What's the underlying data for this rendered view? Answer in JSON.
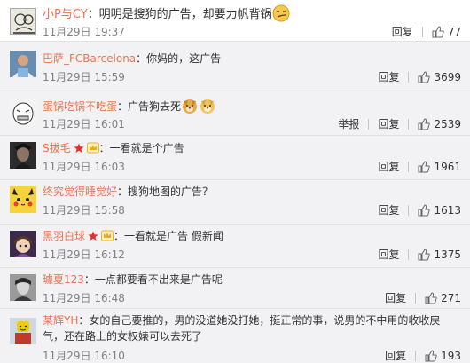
{
  "comments": [
    {
      "user": "小P与CY",
      "text": "：明明是搜狗的广告，却要力帆背锅",
      "emoji": [
        "smirk-emoji"
      ],
      "time": "11月29日 19:37",
      "report": "",
      "reply": "回复",
      "likes": "77",
      "avatar": "meme-drawing-avatar"
    },
    {
      "user": "巴萨_FCBarcelona",
      "text": "：你妈的，这广告",
      "emoji": [],
      "time": "11月29日 15:59",
      "report": "",
      "reply": "回复",
      "likes": "3699",
      "avatar": "footballer-avatar"
    },
    {
      "user": "蛋锅吃锅不吃蛋",
      "text": "：广告狗去死",
      "emoji": [
        "doge-emoji",
        "doge-emoji"
      ],
      "time": "11月29日 16:01",
      "report": "举报",
      "reply": "回复",
      "likes": "2539",
      "avatar": "rage-face-avatar"
    },
    {
      "user": "S拔毛",
      "text": "：一看就是个广告",
      "emoji": [],
      "badges": [
        "star-badge",
        "crown-badge"
      ],
      "time": "11月29日 16:03",
      "report": "",
      "reply": "回复",
      "likes": "1961",
      "avatar": "dark-portrait-avatar"
    },
    {
      "user": "终究觉得睡觉好",
      "text": "：搜狗地图的广告？",
      "emoji": [],
      "time": "11月29日 15:58",
      "report": "",
      "reply": "回复",
      "likes": "1613",
      "avatar": "pikachu-avatar"
    },
    {
      "user": "黑羽白球",
      "text": "：一看就是广告  假新闻",
      "emoji": [],
      "badges": [
        "star-badge",
        "crown-badge"
      ],
      "time": "11月29日 16:12",
      "report": "",
      "reply": "回复",
      "likes": "1375",
      "avatar": "anime-character-avatar"
    },
    {
      "user": "璩夏123",
      "text": "：一点都要看不出来是广告呢",
      "emoji": [],
      "time": "11月29日 16:48",
      "report": "",
      "reply": "回复",
      "likes": "271",
      "avatar": "grayscale-face-avatar"
    },
    {
      "user": "某辉YH",
      "text": "：女的自己要推的，男的没道她没打她，挺正常的事，说男的不中用的收收戾气，还在路上的女权婊可以去死了",
      "emoji": [],
      "time": "11月29日 16:10",
      "report": "",
      "reply": "回复",
      "likes": "193",
      "avatar": "lego-figure-avatar"
    }
  ],
  "colors": {
    "username": "#eb7350",
    "text": "#333333",
    "time": "#808080",
    "background": "#f2f2f5"
  }
}
